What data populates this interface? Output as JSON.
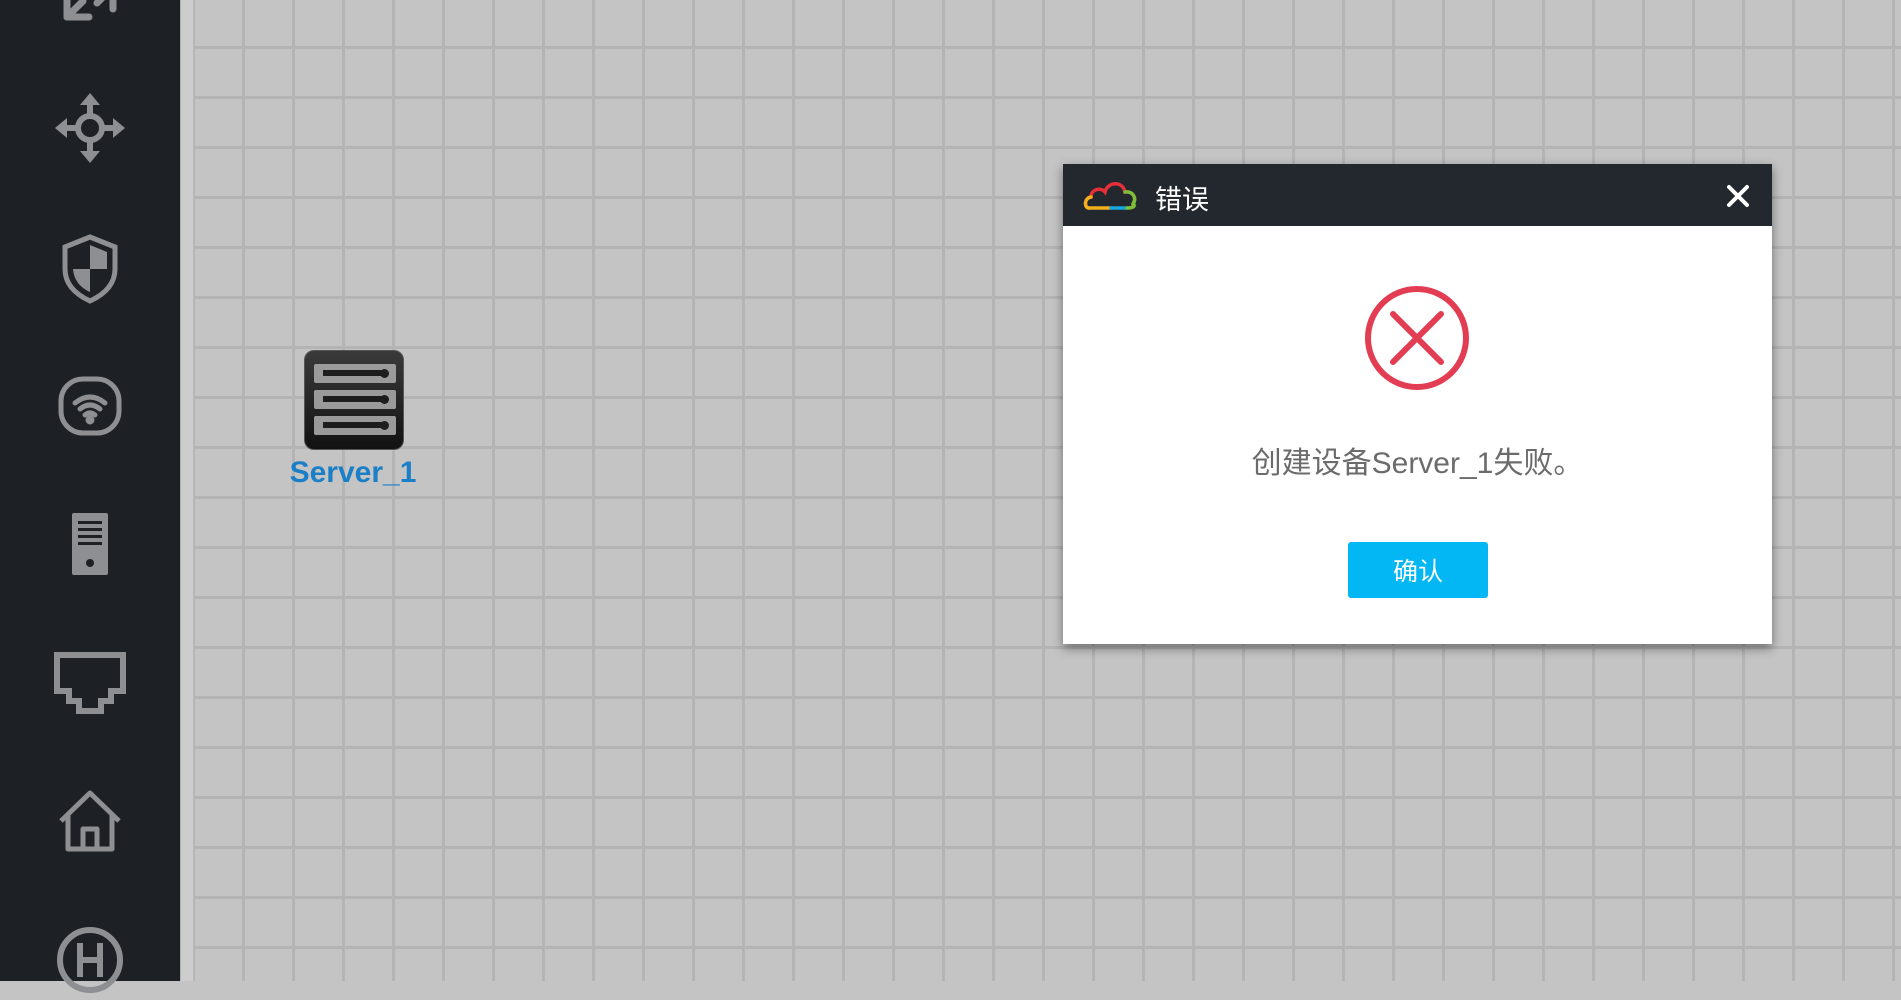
{
  "sidebar": {
    "tools": [
      {
        "icon": "fullscreen-arrows-icon"
      },
      {
        "icon": "move-arrows-icon"
      },
      {
        "icon": "firewall-shield-icon"
      },
      {
        "icon": "wireless-router-icon"
      },
      {
        "icon": "server-tower-icon"
      },
      {
        "icon": "ethernet-port-icon"
      },
      {
        "icon": "home-icon"
      },
      {
        "icon": "hub-icon"
      }
    ]
  },
  "canvas": {
    "nodes": [
      {
        "label": "Server_1",
        "icon": "server-rack-icon"
      }
    ]
  },
  "dialog": {
    "title": "错误",
    "message": "创建设备Server_1失败。",
    "confirm_label": "确认",
    "icon": "error-circle-icon"
  },
  "colors": {
    "sidebar_bg": "#1d2025",
    "canvas_bg": "#c4c4c4",
    "dialog_header_bg": "#23272e",
    "error_red": "#e23d52",
    "confirm_button": "#03b7f5",
    "node_label": "#1a7fc7"
  }
}
